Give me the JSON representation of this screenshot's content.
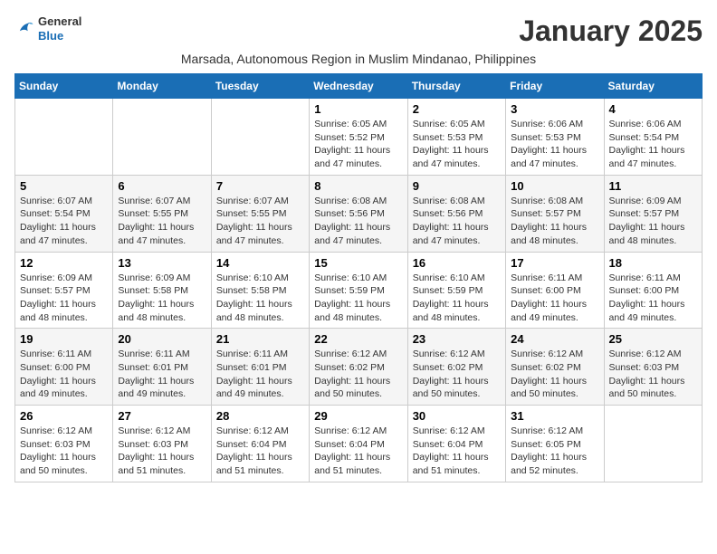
{
  "header": {
    "logo": {
      "general": "General",
      "blue": "Blue"
    },
    "month_title": "January 2025",
    "subtitle": "Marsada, Autonomous Region in Muslim Mindanao, Philippines"
  },
  "weekdays": [
    "Sunday",
    "Monday",
    "Tuesday",
    "Wednesday",
    "Thursday",
    "Friday",
    "Saturday"
  ],
  "weeks": [
    [
      {
        "day": "",
        "sunrise": "",
        "sunset": "",
        "daylight": ""
      },
      {
        "day": "",
        "sunrise": "",
        "sunset": "",
        "daylight": ""
      },
      {
        "day": "",
        "sunrise": "",
        "sunset": "",
        "daylight": ""
      },
      {
        "day": "1",
        "sunrise": "Sunrise: 6:05 AM",
        "sunset": "Sunset: 5:52 PM",
        "daylight": "Daylight: 11 hours and 47 minutes."
      },
      {
        "day": "2",
        "sunrise": "Sunrise: 6:05 AM",
        "sunset": "Sunset: 5:53 PM",
        "daylight": "Daylight: 11 hours and 47 minutes."
      },
      {
        "day": "3",
        "sunrise": "Sunrise: 6:06 AM",
        "sunset": "Sunset: 5:53 PM",
        "daylight": "Daylight: 11 hours and 47 minutes."
      },
      {
        "day": "4",
        "sunrise": "Sunrise: 6:06 AM",
        "sunset": "Sunset: 5:54 PM",
        "daylight": "Daylight: 11 hours and 47 minutes."
      }
    ],
    [
      {
        "day": "5",
        "sunrise": "Sunrise: 6:07 AM",
        "sunset": "Sunset: 5:54 PM",
        "daylight": "Daylight: 11 hours and 47 minutes."
      },
      {
        "day": "6",
        "sunrise": "Sunrise: 6:07 AM",
        "sunset": "Sunset: 5:55 PM",
        "daylight": "Daylight: 11 hours and 47 minutes."
      },
      {
        "day": "7",
        "sunrise": "Sunrise: 6:07 AM",
        "sunset": "Sunset: 5:55 PM",
        "daylight": "Daylight: 11 hours and 47 minutes."
      },
      {
        "day": "8",
        "sunrise": "Sunrise: 6:08 AM",
        "sunset": "Sunset: 5:56 PM",
        "daylight": "Daylight: 11 hours and 47 minutes."
      },
      {
        "day": "9",
        "sunrise": "Sunrise: 6:08 AM",
        "sunset": "Sunset: 5:56 PM",
        "daylight": "Daylight: 11 hours and 47 minutes."
      },
      {
        "day": "10",
        "sunrise": "Sunrise: 6:08 AM",
        "sunset": "Sunset: 5:57 PM",
        "daylight": "Daylight: 11 hours and 48 minutes."
      },
      {
        "day": "11",
        "sunrise": "Sunrise: 6:09 AM",
        "sunset": "Sunset: 5:57 PM",
        "daylight": "Daylight: 11 hours and 48 minutes."
      }
    ],
    [
      {
        "day": "12",
        "sunrise": "Sunrise: 6:09 AM",
        "sunset": "Sunset: 5:57 PM",
        "daylight": "Daylight: 11 hours and 48 minutes."
      },
      {
        "day": "13",
        "sunrise": "Sunrise: 6:09 AM",
        "sunset": "Sunset: 5:58 PM",
        "daylight": "Daylight: 11 hours and 48 minutes."
      },
      {
        "day": "14",
        "sunrise": "Sunrise: 6:10 AM",
        "sunset": "Sunset: 5:58 PM",
        "daylight": "Daylight: 11 hours and 48 minutes."
      },
      {
        "day": "15",
        "sunrise": "Sunrise: 6:10 AM",
        "sunset": "Sunset: 5:59 PM",
        "daylight": "Daylight: 11 hours and 48 minutes."
      },
      {
        "day": "16",
        "sunrise": "Sunrise: 6:10 AM",
        "sunset": "Sunset: 5:59 PM",
        "daylight": "Daylight: 11 hours and 48 minutes."
      },
      {
        "day": "17",
        "sunrise": "Sunrise: 6:11 AM",
        "sunset": "Sunset: 6:00 PM",
        "daylight": "Daylight: 11 hours and 49 minutes."
      },
      {
        "day": "18",
        "sunrise": "Sunrise: 6:11 AM",
        "sunset": "Sunset: 6:00 PM",
        "daylight": "Daylight: 11 hours and 49 minutes."
      }
    ],
    [
      {
        "day": "19",
        "sunrise": "Sunrise: 6:11 AM",
        "sunset": "Sunset: 6:00 PM",
        "daylight": "Daylight: 11 hours and 49 minutes."
      },
      {
        "day": "20",
        "sunrise": "Sunrise: 6:11 AM",
        "sunset": "Sunset: 6:01 PM",
        "daylight": "Daylight: 11 hours and 49 minutes."
      },
      {
        "day": "21",
        "sunrise": "Sunrise: 6:11 AM",
        "sunset": "Sunset: 6:01 PM",
        "daylight": "Daylight: 11 hours and 49 minutes."
      },
      {
        "day": "22",
        "sunrise": "Sunrise: 6:12 AM",
        "sunset": "Sunset: 6:02 PM",
        "daylight": "Daylight: 11 hours and 50 minutes."
      },
      {
        "day": "23",
        "sunrise": "Sunrise: 6:12 AM",
        "sunset": "Sunset: 6:02 PM",
        "daylight": "Daylight: 11 hours and 50 minutes."
      },
      {
        "day": "24",
        "sunrise": "Sunrise: 6:12 AM",
        "sunset": "Sunset: 6:02 PM",
        "daylight": "Daylight: 11 hours and 50 minutes."
      },
      {
        "day": "25",
        "sunrise": "Sunrise: 6:12 AM",
        "sunset": "Sunset: 6:03 PM",
        "daylight": "Daylight: 11 hours and 50 minutes."
      }
    ],
    [
      {
        "day": "26",
        "sunrise": "Sunrise: 6:12 AM",
        "sunset": "Sunset: 6:03 PM",
        "daylight": "Daylight: 11 hours and 50 minutes."
      },
      {
        "day": "27",
        "sunrise": "Sunrise: 6:12 AM",
        "sunset": "Sunset: 6:03 PM",
        "daylight": "Daylight: 11 hours and 51 minutes."
      },
      {
        "day": "28",
        "sunrise": "Sunrise: 6:12 AM",
        "sunset": "Sunset: 6:04 PM",
        "daylight": "Daylight: 11 hours and 51 minutes."
      },
      {
        "day": "29",
        "sunrise": "Sunrise: 6:12 AM",
        "sunset": "Sunset: 6:04 PM",
        "daylight": "Daylight: 11 hours and 51 minutes."
      },
      {
        "day": "30",
        "sunrise": "Sunrise: 6:12 AM",
        "sunset": "Sunset: 6:04 PM",
        "daylight": "Daylight: 11 hours and 51 minutes."
      },
      {
        "day": "31",
        "sunrise": "Sunrise: 6:12 AM",
        "sunset": "Sunset: 6:05 PM",
        "daylight": "Daylight: 11 hours and 52 minutes."
      },
      {
        "day": "",
        "sunrise": "",
        "sunset": "",
        "daylight": ""
      }
    ]
  ]
}
